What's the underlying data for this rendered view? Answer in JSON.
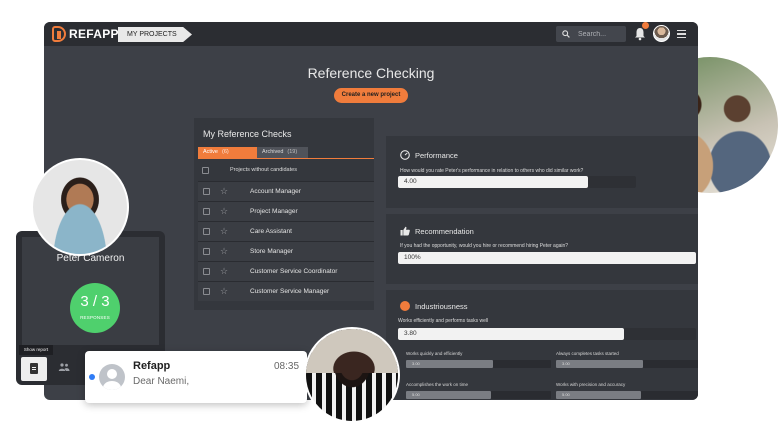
{
  "app": {
    "logo": "REFAPP",
    "breadcrumb": "MY PROJECTS",
    "search_placeholder": "Search...",
    "page_title": "Reference Checking",
    "create_button": "Create a new project"
  },
  "checks": {
    "title": "My Reference Checks",
    "tabs": [
      {
        "label": "Active",
        "count": "(6)"
      },
      {
        "label": "Archived",
        "count": "(19)"
      }
    ],
    "no_candidates": "Projects without candidates",
    "projects": [
      "Account Manager",
      "Project Manager",
      "Care Assistant",
      "Store Manager",
      "Customer Service Coordinator",
      "Customer Service Manager"
    ]
  },
  "panels": {
    "performance": {
      "title": "Performance",
      "question": "How would you rate Peter's performance in relation to others who did similar work?",
      "answer": "4.00",
      "fraction": 0.8
    },
    "recommendation": {
      "title": "Recommendation",
      "question": "If you had the opportunity, would you hire or recommend hiring Peter again?",
      "answer": "100%",
      "fraction": 1.0
    },
    "industriousness": {
      "title": "Industriousness",
      "question": "Works efficiently and performs tasks well",
      "answer": "3.80",
      "fraction": 0.76,
      "sub": [
        {
          "label": "Works quickly and efficiently",
          "value": "3.00",
          "fraction": 0.6
        },
        {
          "label": "Always completes tasks started",
          "value": "3.00",
          "fraction": 0.6
        },
        {
          "label": "Accomplishes the work on time",
          "value": "5.00",
          "fraction": 1.0
        },
        {
          "label": "Works with precision and accuracy",
          "value": "5.00",
          "fraction": 1.0
        }
      ]
    }
  },
  "candidate": {
    "name": "Peter Cameron",
    "score": "3 / 3",
    "score_label": "RESPONSES",
    "show_report": "Show report"
  },
  "notification": {
    "from": "Refapp",
    "time": "08:35",
    "message": "Dear Naemi,"
  },
  "colors": {
    "accent": "#f07c3c",
    "success": "#4fd06d",
    "unread": "#2f7cf6"
  }
}
